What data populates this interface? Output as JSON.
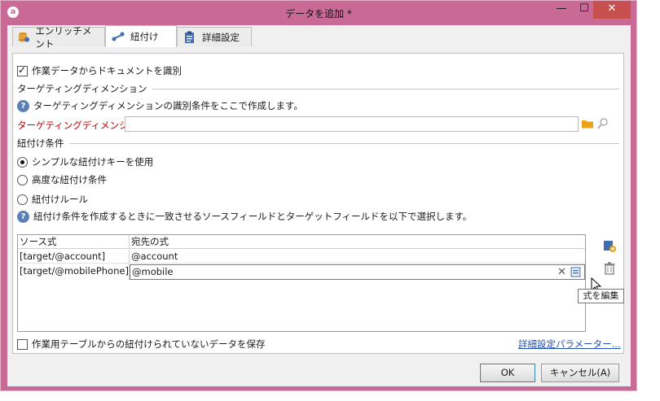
{
  "window": {
    "title": "データを追加 *",
    "controls": {
      "minimize": "—",
      "maximize": "☐",
      "close": "✕"
    }
  },
  "tabs": [
    {
      "label": "エンリッチメント",
      "icon": "database-icon"
    },
    {
      "label": "紐付け",
      "icon": "link-icon",
      "active": true
    },
    {
      "label": "詳細設定",
      "icon": "clipboard-icon"
    }
  ],
  "identify_checkbox": {
    "label": "作業データからドキュメントを識別",
    "checked": true
  },
  "targeting": {
    "section_title": "ターゲティングディメンション",
    "help_text": "ターゲティングディメンションの識別条件をここで作成します。",
    "field_label": "ターゲティングディメンション:",
    "field_value": ""
  },
  "reconciliation": {
    "section_title": "紐付け条件",
    "options": [
      {
        "label": "シンプルな紐付けキーを使用",
        "checked": true
      },
      {
        "label": "高度な紐付け条件",
        "checked": false
      },
      {
        "label": "紐付けルール",
        "checked": false
      }
    ],
    "help_text": "紐付け条件を作成するときに一致させるソースフィールドとターゲットフィールドを以下で選択します。"
  },
  "grid": {
    "columns": [
      "ソース式",
      "宛先の式"
    ],
    "rows": [
      {
        "source": "[target/@account]",
        "dest": "@account"
      },
      {
        "source": "[target/@mobilePhone]",
        "dest": "@mobile"
      }
    ]
  },
  "tooltip": "式を編集",
  "keep_unreconciled": {
    "label": "作業用テーブルからの紐付けられていないデータを保存",
    "checked": false
  },
  "advanced_link": "詳細設定パラメーター...",
  "buttons": {
    "ok": "OK",
    "cancel": "キャンセル(A)"
  },
  "colors": {
    "titlebar": "#c96a96",
    "close": "#c7504f",
    "link": "#1f4eb8",
    "required": "#c00000"
  }
}
